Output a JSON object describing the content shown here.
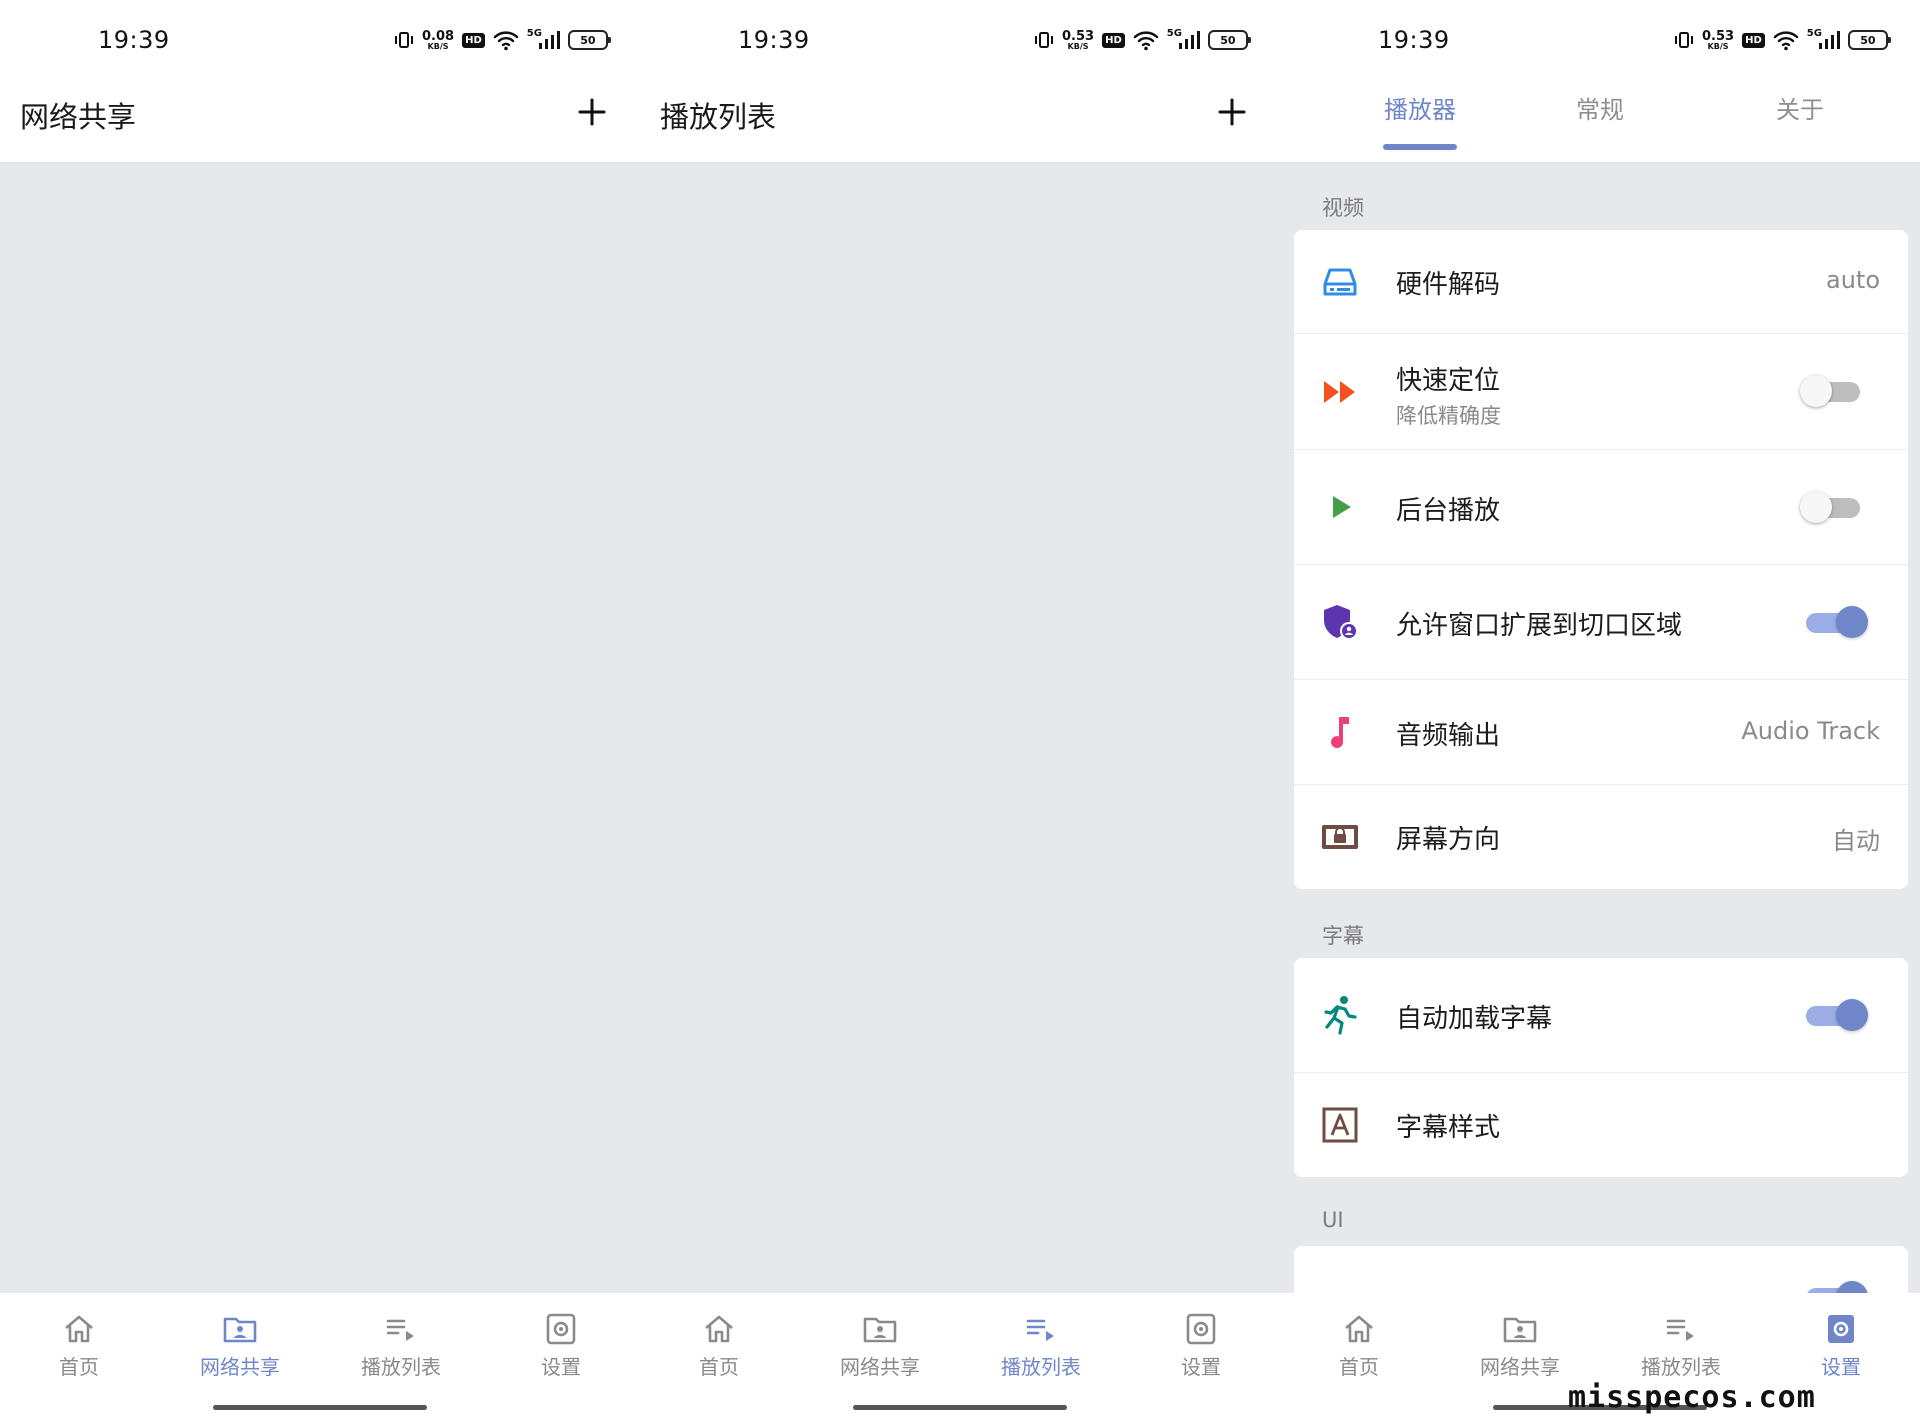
{
  "status_bar": {
    "time": "19:39",
    "net_speed": [
      "0.08",
      "0.53",
      "0.53"
    ],
    "net_unit": "KB/S",
    "hd_badge": "HD",
    "signal_label": "5G",
    "battery": "50"
  },
  "panels": [
    {
      "title": "网络共享",
      "add_button": "+"
    },
    {
      "title": "播放列表",
      "add_button": "+"
    }
  ],
  "settings_tabs": [
    "播放器",
    "常规",
    "关于"
  ],
  "settings_tab_active": "播放器",
  "sections": {
    "video": {
      "label": "视频",
      "items": [
        {
          "title": "硬件解码",
          "value": "auto",
          "icon": "hard-drive-icon"
        },
        {
          "title": "快速定位",
          "subtitle": "降低精确度",
          "toggle": "off",
          "icon": "fast-forward-icon"
        },
        {
          "title": "后台播放",
          "toggle": "off",
          "icon": "play-icon"
        },
        {
          "title": "允许窗口扩展到切口区域",
          "toggle": "on",
          "icon": "shield-user-icon"
        },
        {
          "title": "音频输出",
          "value": "Audio Track",
          "icon": "music-note-icon"
        },
        {
          "title": "屏幕方向",
          "value": "自动",
          "icon": "screen-lock-icon"
        }
      ]
    },
    "subtitles": {
      "label": "字幕",
      "items": [
        {
          "title": "自动加载字幕",
          "toggle": "on",
          "icon": "running-icon"
        },
        {
          "title": "字幕样式",
          "icon": "font-box-icon"
        }
      ]
    },
    "ui": {
      "label": "UI"
    }
  },
  "bottom_nav": [
    "首页",
    "网络共享",
    "播放列表",
    "设置"
  ],
  "bottom_nav_active": [
    "网络共享",
    "播放列表",
    "设置"
  ],
  "colors": {
    "accent": "#6f87c9",
    "background": "#e7e8eb",
    "hardware_icon": "#2f8de4",
    "fast_forward_icon": "#f4511e",
    "play_icon": "#43a047",
    "shield_icon": "#5e35b1",
    "music_icon": "#ec407a",
    "screen_icon": "#6d4c41",
    "run_icon": "#00897b",
    "font_icon": "#6d4c41"
  },
  "watermark": "misspecos.com"
}
